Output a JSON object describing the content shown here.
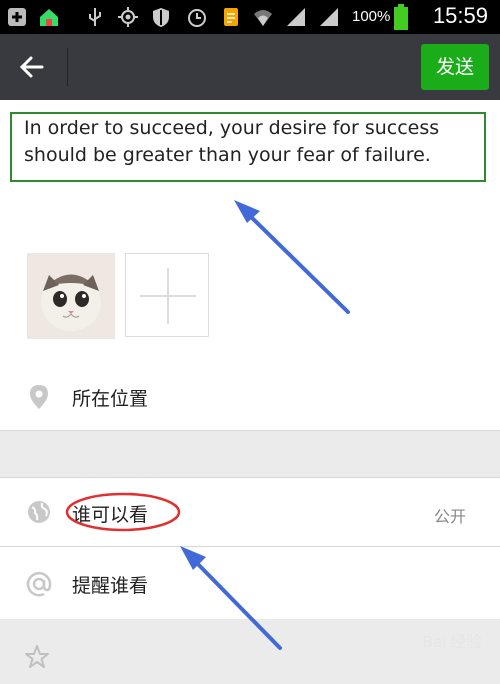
{
  "status_bar": {
    "battery_percent": "100%",
    "time": "15:59",
    "icons": [
      "plus-box-icon",
      "house-icon",
      "usb-icon",
      "gps-icon",
      "shield-icon",
      "alarm-icon",
      "file-icon",
      "wifi-icon",
      "signal-icon",
      "signal-icon",
      "battery-icon"
    ]
  },
  "app_bar": {
    "back_icon": "arrow-left-icon",
    "send_label": "发送",
    "send_color": "#1aad19"
  },
  "compose": {
    "text": "In order to succeed, your desire for success should be greater than your fear of failure.",
    "highlight_color": "#2e8b2e"
  },
  "images": {
    "thumbnail_alt": "kitten photo",
    "add_icon": "plus-icon"
  },
  "rows": {
    "location_label": "所在位置",
    "visibility_label": "谁可以看",
    "visibility_value": "公开",
    "remind_label": "提醒谁看"
  },
  "watermark": "Bai 经验"
}
